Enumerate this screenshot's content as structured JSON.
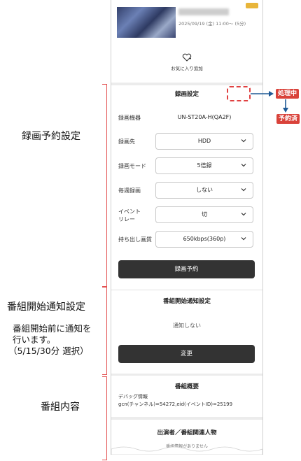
{
  "program": {
    "air_time": "2025/09/19 (金) 11:00～ (5分)",
    "favorite_label": "お気に入り追加"
  },
  "recording": {
    "title": "録画設定",
    "device_label": "録画機器",
    "device_value": "UN-ST20A-H(QA2F)",
    "dest_label": "録画先",
    "dest_value": "HDD",
    "mode_label": "録画モード",
    "mode_value": "5倍録",
    "weekly_label": "毎週録画",
    "weekly_value": "しない",
    "relay_label_1": "イベント",
    "relay_label_2": "リレー",
    "relay_value": "切",
    "quality_label": "持ち出し画質",
    "quality_value": "650kbps(360p)",
    "reserve_button": "録画予約"
  },
  "notification": {
    "title": "番組開始通知設定",
    "status": "通知しない",
    "change_button": "変更"
  },
  "overview": {
    "title": "番組概要",
    "debug_line1": "デバッグ情報",
    "debug_line2": "gcn(チャンネル)=54272,eid(イベントID)=25199"
  },
  "cast": {
    "title": "出演者／番組関連人物",
    "empty": "番組情報がありません"
  },
  "annotations": {
    "recording_section": "録画予約設定",
    "notification_section": "番組開始通知設定",
    "notification_desc_1": "番組開始前に通知を",
    "notification_desc_2": "行います。",
    "notification_desc_3": "（5/15/30分 選択）",
    "overview_section": "番組内容",
    "state_processing": "処理中",
    "state_reserved": "予約済"
  },
  "colors": {
    "accent_red": "#d9423a",
    "button_dark": "#333333",
    "logo_yellow": "#e8b53a"
  }
}
